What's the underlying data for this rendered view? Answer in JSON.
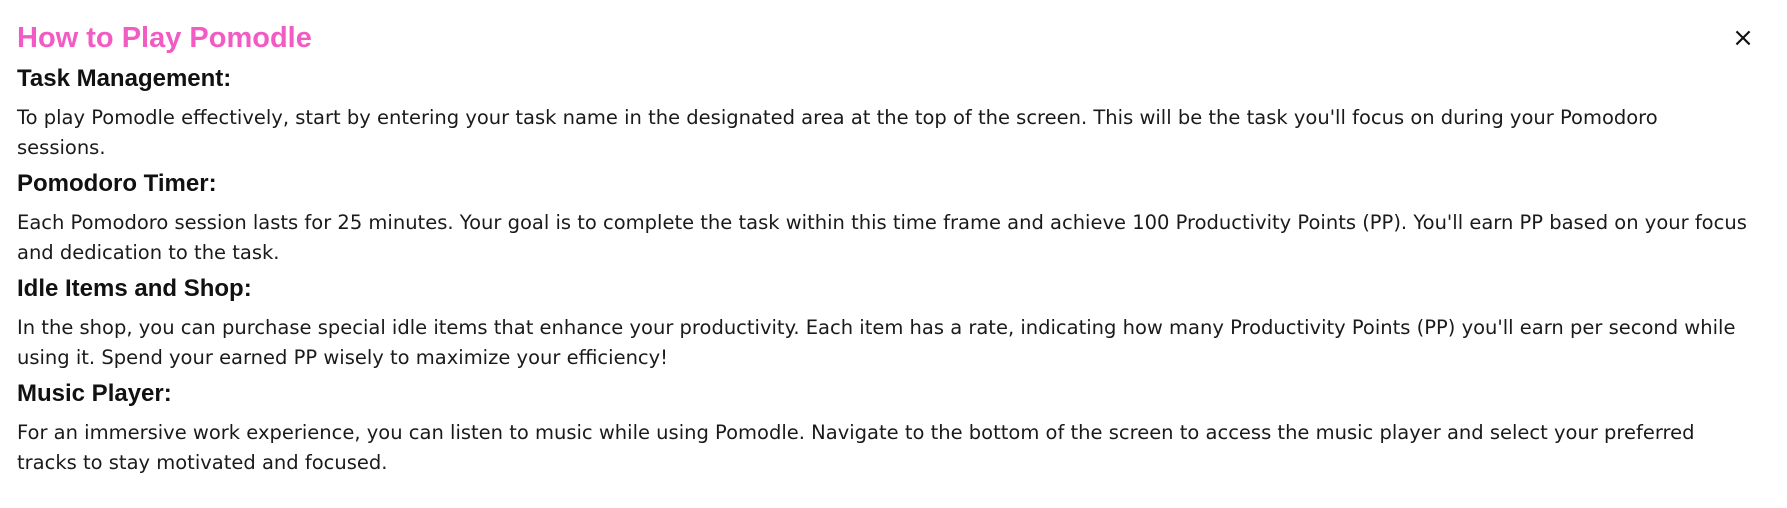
{
  "dialog": {
    "title": "How to Play Pomodle",
    "close_label": "×",
    "title_color": "#f25bc4"
  },
  "sections": [
    {
      "heading": "Task Management:",
      "body": "To play Pomodle effectively, start by entering your task name in the designated area at the top of the screen. This will be the task you'll focus on during your Pomodoro sessions."
    },
    {
      "heading": "Pomodoro Timer:",
      "body": "Each Pomodoro session lasts for 25 minutes. Your goal is to complete the task within this time frame and achieve 100 Productivity Points (PP). You'll earn PP based on your focus and dedication to the task."
    },
    {
      "heading": "Idle Items and Shop:",
      "body": "In the shop, you can purchase special idle items that enhance your productivity. Each item has a rate, indicating how many Productivity Points (PP) you'll earn per second while using it. Spend your earned PP wisely to maximize your efficiency!"
    },
    {
      "heading": "Music Player:",
      "body": "For an immersive work experience, you can listen to music while using Pomodle. Navigate to the bottom of the screen to access the music player and select your preferred tracks to stay motivated and focused."
    }
  ]
}
